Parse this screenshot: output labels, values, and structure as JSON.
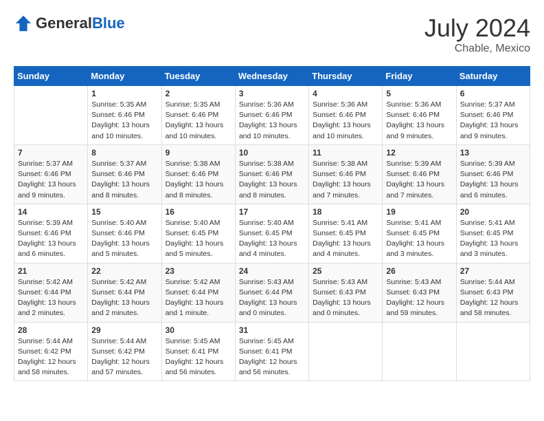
{
  "header": {
    "logo_general": "General",
    "logo_blue": "Blue",
    "month_year": "July 2024",
    "location": "Chable, Mexico"
  },
  "weekdays": [
    "Sunday",
    "Monday",
    "Tuesday",
    "Wednesday",
    "Thursday",
    "Friday",
    "Saturday"
  ],
  "weeks": [
    [
      {
        "day": "",
        "sunrise": "",
        "sunset": "",
        "daylight": ""
      },
      {
        "day": "1",
        "sunrise": "Sunrise: 5:35 AM",
        "sunset": "Sunset: 6:46 PM",
        "daylight": "Daylight: 13 hours and 10 minutes."
      },
      {
        "day": "2",
        "sunrise": "Sunrise: 5:35 AM",
        "sunset": "Sunset: 6:46 PM",
        "daylight": "Daylight: 13 hours and 10 minutes."
      },
      {
        "day": "3",
        "sunrise": "Sunrise: 5:36 AM",
        "sunset": "Sunset: 6:46 PM",
        "daylight": "Daylight: 13 hours and 10 minutes."
      },
      {
        "day": "4",
        "sunrise": "Sunrise: 5:36 AM",
        "sunset": "Sunset: 6:46 PM",
        "daylight": "Daylight: 13 hours and 10 minutes."
      },
      {
        "day": "5",
        "sunrise": "Sunrise: 5:36 AM",
        "sunset": "Sunset: 6:46 PM",
        "daylight": "Daylight: 13 hours and 9 minutes."
      },
      {
        "day": "6",
        "sunrise": "Sunrise: 5:37 AM",
        "sunset": "Sunset: 6:46 PM",
        "daylight": "Daylight: 13 hours and 9 minutes."
      }
    ],
    [
      {
        "day": "7",
        "sunrise": "Sunrise: 5:37 AM",
        "sunset": "Sunset: 6:46 PM",
        "daylight": "Daylight: 13 hours and 9 minutes."
      },
      {
        "day": "8",
        "sunrise": "Sunrise: 5:37 AM",
        "sunset": "Sunset: 6:46 PM",
        "daylight": "Daylight: 13 hours and 8 minutes."
      },
      {
        "day": "9",
        "sunrise": "Sunrise: 5:38 AM",
        "sunset": "Sunset: 6:46 PM",
        "daylight": "Daylight: 13 hours and 8 minutes."
      },
      {
        "day": "10",
        "sunrise": "Sunrise: 5:38 AM",
        "sunset": "Sunset: 6:46 PM",
        "daylight": "Daylight: 13 hours and 8 minutes."
      },
      {
        "day": "11",
        "sunrise": "Sunrise: 5:38 AM",
        "sunset": "Sunset: 6:46 PM",
        "daylight": "Daylight: 13 hours and 7 minutes."
      },
      {
        "day": "12",
        "sunrise": "Sunrise: 5:39 AM",
        "sunset": "Sunset: 6:46 PM",
        "daylight": "Daylight: 13 hours and 7 minutes."
      },
      {
        "day": "13",
        "sunrise": "Sunrise: 5:39 AM",
        "sunset": "Sunset: 6:46 PM",
        "daylight": "Daylight: 13 hours and 6 minutes."
      }
    ],
    [
      {
        "day": "14",
        "sunrise": "Sunrise: 5:39 AM",
        "sunset": "Sunset: 6:46 PM",
        "daylight": "Daylight: 13 hours and 6 minutes."
      },
      {
        "day": "15",
        "sunrise": "Sunrise: 5:40 AM",
        "sunset": "Sunset: 6:46 PM",
        "daylight": "Daylight: 13 hours and 5 minutes."
      },
      {
        "day": "16",
        "sunrise": "Sunrise: 5:40 AM",
        "sunset": "Sunset: 6:45 PM",
        "daylight": "Daylight: 13 hours and 5 minutes."
      },
      {
        "day": "17",
        "sunrise": "Sunrise: 5:40 AM",
        "sunset": "Sunset: 6:45 PM",
        "daylight": "Daylight: 13 hours and 4 minutes."
      },
      {
        "day": "18",
        "sunrise": "Sunrise: 5:41 AM",
        "sunset": "Sunset: 6:45 PM",
        "daylight": "Daylight: 13 hours and 4 minutes."
      },
      {
        "day": "19",
        "sunrise": "Sunrise: 5:41 AM",
        "sunset": "Sunset: 6:45 PM",
        "daylight": "Daylight: 13 hours and 3 minutes."
      },
      {
        "day": "20",
        "sunrise": "Sunrise: 5:41 AM",
        "sunset": "Sunset: 6:45 PM",
        "daylight": "Daylight: 13 hours and 3 minutes."
      }
    ],
    [
      {
        "day": "21",
        "sunrise": "Sunrise: 5:42 AM",
        "sunset": "Sunset: 6:44 PM",
        "daylight": "Daylight: 13 hours and 2 minutes."
      },
      {
        "day": "22",
        "sunrise": "Sunrise: 5:42 AM",
        "sunset": "Sunset: 6:44 PM",
        "daylight": "Daylight: 13 hours and 2 minutes."
      },
      {
        "day": "23",
        "sunrise": "Sunrise: 5:42 AM",
        "sunset": "Sunset: 6:44 PM",
        "daylight": "Daylight: 13 hours and 1 minute."
      },
      {
        "day": "24",
        "sunrise": "Sunrise: 5:43 AM",
        "sunset": "Sunset: 6:44 PM",
        "daylight": "Daylight: 13 hours and 0 minutes."
      },
      {
        "day": "25",
        "sunrise": "Sunrise: 5:43 AM",
        "sunset": "Sunset: 6:43 PM",
        "daylight": "Daylight: 13 hours and 0 minutes."
      },
      {
        "day": "26",
        "sunrise": "Sunrise: 5:43 AM",
        "sunset": "Sunset: 6:43 PM",
        "daylight": "Daylight: 12 hours and 59 minutes."
      },
      {
        "day": "27",
        "sunrise": "Sunrise: 5:44 AM",
        "sunset": "Sunset: 6:43 PM",
        "daylight": "Daylight: 12 hours and 58 minutes."
      }
    ],
    [
      {
        "day": "28",
        "sunrise": "Sunrise: 5:44 AM",
        "sunset": "Sunset: 6:42 PM",
        "daylight": "Daylight: 12 hours and 58 minutes."
      },
      {
        "day": "29",
        "sunrise": "Sunrise: 5:44 AM",
        "sunset": "Sunset: 6:42 PM",
        "daylight": "Daylight: 12 hours and 57 minutes."
      },
      {
        "day": "30",
        "sunrise": "Sunrise: 5:45 AM",
        "sunset": "Sunset: 6:41 PM",
        "daylight": "Daylight: 12 hours and 56 minutes."
      },
      {
        "day": "31",
        "sunrise": "Sunrise: 5:45 AM",
        "sunset": "Sunset: 6:41 PM",
        "daylight": "Daylight: 12 hours and 56 minutes."
      },
      {
        "day": "",
        "sunrise": "",
        "sunset": "",
        "daylight": ""
      },
      {
        "day": "",
        "sunrise": "",
        "sunset": "",
        "daylight": ""
      },
      {
        "day": "",
        "sunrise": "",
        "sunset": "",
        "daylight": ""
      }
    ]
  ]
}
